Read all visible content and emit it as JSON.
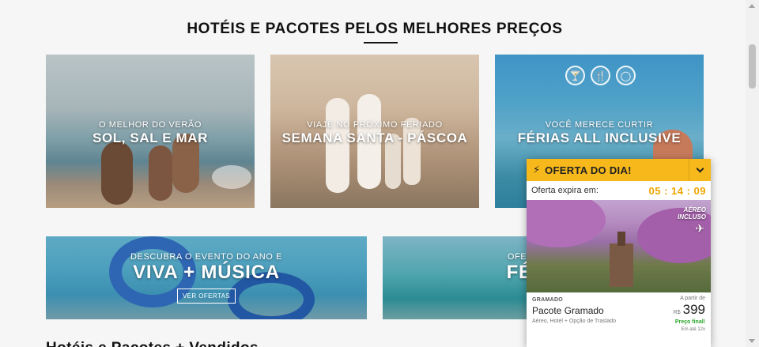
{
  "section": {
    "title": "HOTÉIS E PACOTES PELOS MELHORES PREÇOS"
  },
  "cards": [
    {
      "subtitle": "O MELHOR DO VERÃO",
      "title": "SOL, SAL E MAR"
    },
    {
      "subtitle": "VIAJE NO PRÓXIMO FERIADO",
      "title": "SEMANA SANTA - PÁSCOA"
    },
    {
      "subtitle": "VOCÊ MERECE CURTIR",
      "title": "FÉRIAS ALL INCLUSIVE",
      "icons": [
        "cocktail-icon",
        "food-icon",
        "volleyball-icon"
      ]
    },
    {
      "subtitle": "DESCUBRA O EVENTO DO ANO E",
      "title": "VIVA + MÚSICA",
      "cta": "VER OFERTAS"
    },
    {
      "subtitle": "OFERTAS PARA",
      "title": "FÉRIAS"
    }
  ],
  "bottom_heading": "Hotéis e Pacotes + Vendidos",
  "deal": {
    "header": "OFERTA DO DIA!",
    "expire_label": "Oferta expira em:",
    "timer": "05 : 14 : 09",
    "badge": "AÉREO INCLUSO",
    "location": "GRAMADO",
    "name": "Pacote Gramado",
    "description": "Aéreo, Hotel + Opção de Traslado",
    "from_label": "A partir de",
    "currency": "R$",
    "price": "399",
    "final_label": "Preço final!",
    "installments": "Em até 12x"
  },
  "colors": {
    "accent": "#f6b81a",
    "timer": "#f0a500",
    "final_price": "#2aa52a"
  }
}
